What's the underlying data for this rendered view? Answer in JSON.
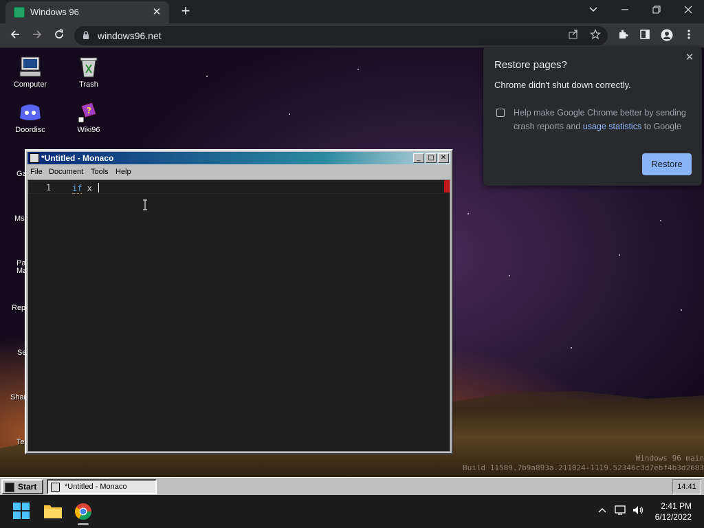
{
  "browser": {
    "tab_title": "Windows 96",
    "tab_close": "✕",
    "new_tab": "+",
    "url": "windows96.net"
  },
  "popup": {
    "title": "Restore pages?",
    "message": "Chrome didn't shut down correctly.",
    "checkbox_text_before": "Help make Google Chrome better by sending crash reports and ",
    "checkbox_link": "usage statistics",
    "checkbox_text_after": " to Google",
    "restore_label": "Restore",
    "close": "✕"
  },
  "desktop": {
    "icons": [
      {
        "label": "Computer"
      },
      {
        "label": "Trash"
      },
      {
        "label": "Doordisc"
      },
      {
        "label": "Wiki96"
      }
    ],
    "partial_labels": [
      "Ga",
      "Ms",
      "Pa",
      "Ma",
      "Rep",
      "Se",
      "Shar",
      "Te"
    ],
    "build_line1": "Windows 96 main",
    "build_line2": "Build 11589.7b9a893a.211024-1119.52346c3d7ebf4b3d2683"
  },
  "monaco": {
    "title": "*Untitled - Monaco",
    "menu": [
      "File",
      "Document",
      "Tools",
      "Help"
    ],
    "line_number": "1",
    "code_keyword": "if",
    "code_rest": " x ",
    "btn_min": "_",
    "btn_max": "□",
    "btn_close": "✕"
  },
  "w96taskbar": {
    "start_label": "Start",
    "task_label": "*Untitled - Monaco",
    "clock": "14:41"
  },
  "w11taskbar": {
    "time": "2:41 PM",
    "date": "6/12/2022"
  },
  "colors": {
    "chrome_dark": "#202124",
    "accent_blue": "#8ab4f8",
    "win96_gray": "#c0c0c0",
    "editor_bg": "#1e1e1e"
  }
}
